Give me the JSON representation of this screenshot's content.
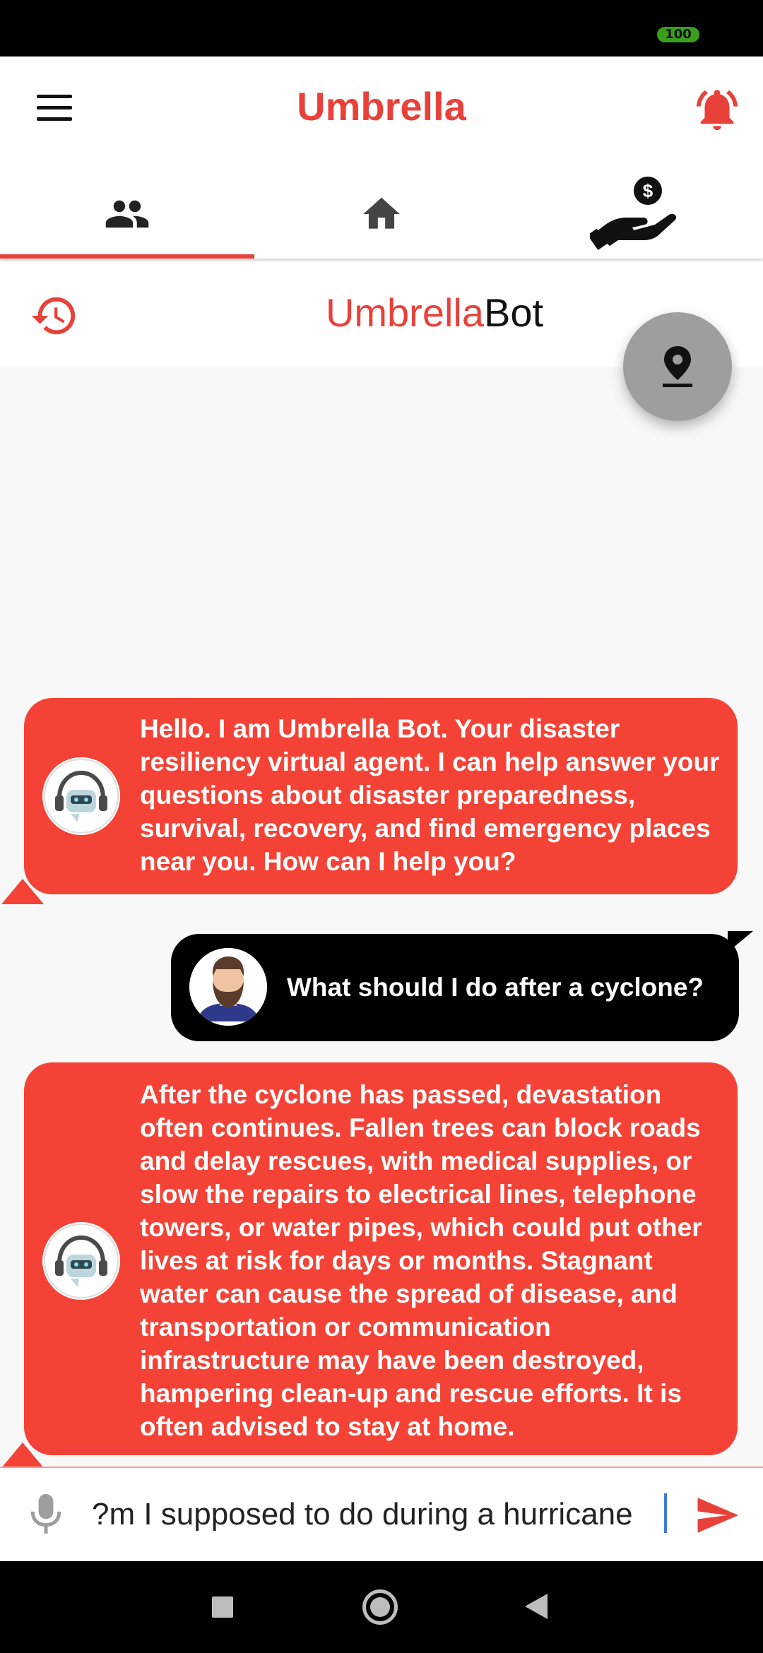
{
  "status_bar": {
    "battery": "100"
  },
  "app_bar": {
    "title": "Umbrella",
    "menu_icon": "hamburger-menu-icon",
    "bell_icon": "notification-bell-icon"
  },
  "tabs": [
    {
      "name": "community",
      "icon": "people-icon",
      "selected": true
    },
    {
      "name": "home",
      "icon": "home-icon",
      "selected": false
    },
    {
      "name": "donate",
      "icon": "hand-money-icon",
      "selected": false
    }
  ],
  "bot_header": {
    "title_red": "Umbrella",
    "title_black": "Bot",
    "history_icon": "history-icon"
  },
  "fab": {
    "icon": "location-pin-icon"
  },
  "messages": [
    {
      "sender": "bot",
      "text": "Hello. I am Umbrella Bot. Your disaster resiliency virtual agent. I can help answer your questions about disaster preparedness, survival, recovery, and find emergency places near you. How can I help you?"
    },
    {
      "sender": "user",
      "text": "What should I do after a cyclone?"
    },
    {
      "sender": "bot",
      "text": "After the cyclone has passed, devastation often continues. Fallen trees can block roads and delay rescues, with medical supplies, or slow the repairs to electrical lines, telephone towers, or water pipes, which could put other lives at risk for days or months. Stagnant water can cause the spread of disease, and transportation or communication infrastructure may have been destroyed, hampering clean-up and rescue efforts. It is often advised to stay at home."
    }
  ],
  "input": {
    "value": "m I supposed to do during a hurricane?"
  },
  "colors": {
    "accent": "#e8413a",
    "bot_bubble": "#f44336",
    "user_bubble": "#000000",
    "fab": "#9e9e9e"
  }
}
